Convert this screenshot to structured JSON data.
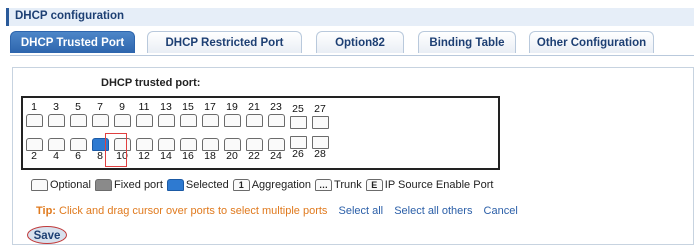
{
  "header": {
    "title": "DHCP configuration"
  },
  "tabs": [
    {
      "label": "DHCP Trusted Port",
      "active": true
    },
    {
      "label": "DHCP Restricted Port",
      "active": false
    },
    {
      "label": "Option82",
      "active": false
    },
    {
      "label": "Binding Table",
      "active": false
    },
    {
      "label": "Other Configuration",
      "active": false
    }
  ],
  "section": {
    "label": "DHCP trusted port:"
  },
  "ports": {
    "top": [
      "1",
      "3",
      "5",
      "7",
      "9",
      "11",
      "13",
      "15",
      "17",
      "19",
      "21",
      "23",
      "25",
      "27"
    ],
    "bottom": [
      "2",
      "4",
      "6",
      "8",
      "10",
      "12",
      "14",
      "16",
      "18",
      "20",
      "22",
      "24",
      "26",
      "28"
    ],
    "selected": [
      "8"
    ]
  },
  "legend": {
    "optional": "Optional",
    "fixed": "Fixed port",
    "selected": "Selected",
    "aggregation_icon": "1",
    "aggregation": "Aggregation",
    "trunk_icon": "…",
    "trunk": "Trunk",
    "ip_source_icon": "E",
    "ip_source": "IP Source Enable Port"
  },
  "tip": {
    "label": "Tip:",
    "text": "Click and drag cursor over ports to select multiple ports",
    "select_all": "Select all",
    "select_others": "Select all others",
    "cancel": "Cancel"
  },
  "actions": {
    "save": "Save"
  },
  "colors": {
    "accent": "#2d65ad",
    "selected_port": "#2e7ad1",
    "tip": "#e07a1e",
    "link": "#2b5fa8"
  }
}
